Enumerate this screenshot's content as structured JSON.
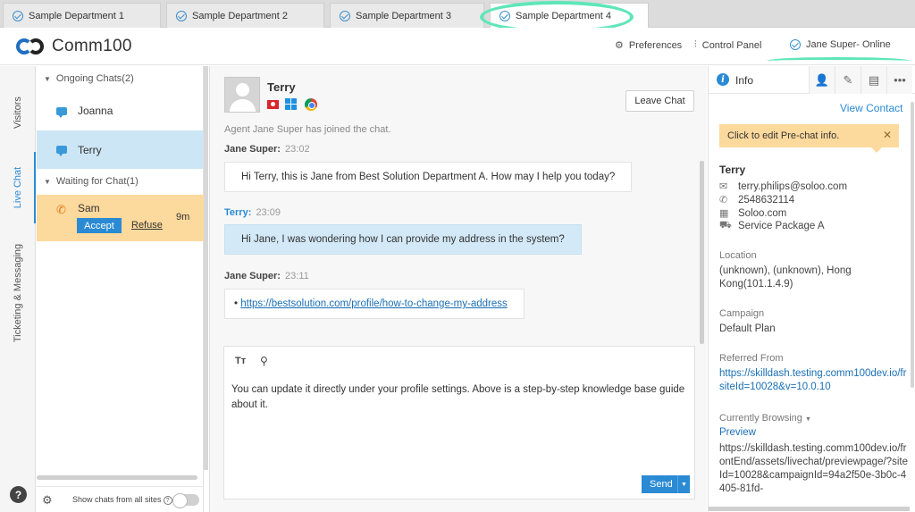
{
  "tabs": [
    {
      "label": "Sample Department 1"
    },
    {
      "label": "Sample Department 2"
    },
    {
      "label": "Sample Department 3"
    },
    {
      "label": "Sample Department 4"
    }
  ],
  "header": {
    "logo_text": "Comm100",
    "preferences": "Preferences",
    "control_panel": "Control Panel",
    "agent_status": "Jane Super- Online"
  },
  "vnav": {
    "visitors": "Visitors",
    "live_chat": "Live Chat",
    "ticketing": "Ticketing & Messaging",
    "help": "?"
  },
  "chatlist": {
    "ongoing_header": "Ongoing Chats(2)",
    "ongoing": [
      {
        "name": "Joanna"
      },
      {
        "name": "Terry"
      }
    ],
    "waiting_header": "Waiting for Chat(1)",
    "waiting": {
      "name": "Sam",
      "accept": "Accept",
      "refuse": "Refuse",
      "time": "9m"
    },
    "show_all": "Show chats from all sites"
  },
  "chat": {
    "visitor_name": "Terry",
    "leave": "Leave Chat",
    "system_message": "Agent Jane Super has joined the chat.",
    "messages": [
      {
        "author": "Jane Super:",
        "time": "23:02",
        "text": "Hi Terry, this is Jane from Best Solution Department A. How may I help you today?"
      },
      {
        "author": "Terry:",
        "time": "23:09",
        "text": "Hi Jane, I was wondering how I can provide my address in the system?"
      },
      {
        "author": "Jane Super:",
        "time": "23:11",
        "text": "https://bestsolution.com/profile/how-to-change-my-address"
      }
    ],
    "compose_text": "You can update it directly under your profile settings. Above is a step-by-step knowledge base guide about it.",
    "toolbar_font": "Tт",
    "send": "Send"
  },
  "info": {
    "title": "Info",
    "view_contact": "View Contact",
    "prechat_hint": "Click to edit Pre-chat info.",
    "name": "Terry",
    "email": "terry.philips@soloo.com",
    "phone": "2548632114",
    "company": "Soloo.com",
    "product": "Service Package A",
    "location_label": "Location",
    "location_value": "(unknown), (unknown), Hong Kong(101.1.4.9)",
    "campaign_label": "Campaign",
    "campaign_value": "Default Plan",
    "referred_label": "Referred From",
    "referred_value": "https://skilldash.testing.comm100dev.io/frsiteId=10028&v=10.0.10",
    "browsing_label": "Currently Browsing",
    "preview": "Preview",
    "browsing_value": "https://skilldash.testing.comm100dev.io/frontEnd/assets/livechat/previewpage/?siteId=10028&campaignId=94a2f50e-3b0c-4405-81fd-"
  },
  "colors": {
    "accent": "#2a8ad4",
    "highlight": "#5fe6b8",
    "waiting_bg": "#fcd99c",
    "selected_bg": "#cde6f5"
  }
}
